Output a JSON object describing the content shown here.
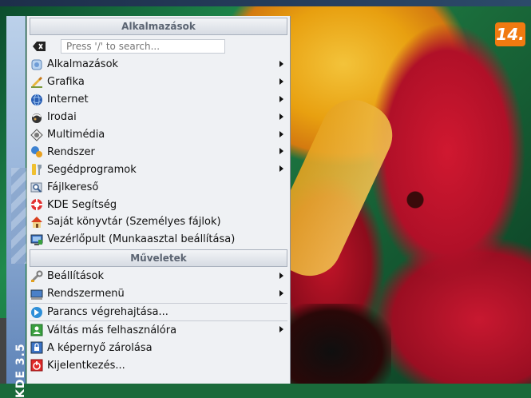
{
  "badge": "14.",
  "sidebar_label": "KDE 3.5",
  "menu": {
    "title": "Alkalmazások",
    "search_placeholder": "Press '/' to search...",
    "apps": [
      {
        "label": "Alkalmazások",
        "icon": "applications-icon",
        "submenu": true
      },
      {
        "label": "Grafika",
        "icon": "graphics-icon",
        "submenu": true
      },
      {
        "label": "Internet",
        "icon": "internet-globe-icon",
        "submenu": true
      },
      {
        "label": "Irodai",
        "icon": "office-icon",
        "submenu": true
      },
      {
        "label": "Multimédia",
        "icon": "multimedia-icon",
        "submenu": true
      },
      {
        "label": "Rendszer",
        "icon": "system-icon",
        "submenu": true
      },
      {
        "label": "Segédprogramok",
        "icon": "utilities-icon",
        "submenu": true
      },
      {
        "label": "Fájlkereső",
        "icon": "file-search-icon",
        "submenu": false
      },
      {
        "label": "KDE Segítség",
        "icon": "help-lifebuoy-icon",
        "submenu": false
      },
      {
        "label": "Saját könyvtár (Személyes fájlok)",
        "icon": "home-folder-icon",
        "submenu": false
      },
      {
        "label": "Vezérlőpult (Munkaasztal beállítása)",
        "icon": "control-center-icon",
        "submenu": false
      }
    ],
    "actions_title": "Műveletek",
    "actions": [
      {
        "label": "Beállítások",
        "icon": "settings-wrench-icon",
        "submenu": true
      },
      {
        "label": "Rendszermenü",
        "icon": "system-menu-icon",
        "submenu": true
      },
      {
        "label": "Parancs végrehajtása...",
        "icon": "run-command-icon",
        "submenu": false
      },
      {
        "label": "Váltás más felhasználóra",
        "icon": "switch-user-icon",
        "submenu": true
      },
      {
        "label": "A képernyő zárolása",
        "icon": "lock-screen-icon",
        "submenu": false
      },
      {
        "label": "Kijelentkezés...",
        "icon": "logout-icon",
        "submenu": false
      }
    ]
  }
}
